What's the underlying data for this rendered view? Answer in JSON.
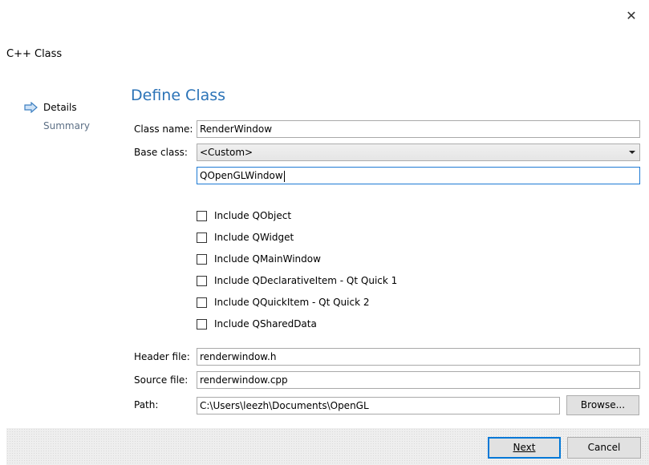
{
  "window": {
    "title": "C++ Class",
    "close_glyph": "✕"
  },
  "nav": {
    "items": [
      {
        "label": "Details",
        "active": true,
        "icon": "arrow-right-icon"
      },
      {
        "label": "Summary",
        "active": false
      }
    ]
  },
  "page": {
    "heading": "Define Class"
  },
  "form": {
    "class_name": {
      "label": "Class name:",
      "value": "RenderWindow"
    },
    "base_class": {
      "label": "Base class:",
      "selected": "<Custom>",
      "custom_value": "QOpenGLWindow"
    },
    "includes": [
      {
        "label": "Include QObject",
        "checked": false
      },
      {
        "label": "Include QWidget",
        "checked": false
      },
      {
        "label": "Include QMainWindow",
        "checked": false
      },
      {
        "label": "Include QDeclarativeItem - Qt Quick 1",
        "checked": false
      },
      {
        "label": "Include QQuickItem - Qt Quick 2",
        "checked": false
      },
      {
        "label": "Include QSharedData",
        "checked": false
      }
    ],
    "header_file": {
      "label": "Header file:",
      "value": "renderwindow.h"
    },
    "source_file": {
      "label": "Source file:",
      "value": "renderwindow.cpp"
    },
    "path": {
      "label": "Path:",
      "value": "C:\\Users\\leezh\\Documents\\OpenGL",
      "browse_label": "Browse..."
    }
  },
  "footer": {
    "next_label": "Next",
    "cancel_label": "Cancel"
  },
  "colors": {
    "accent": "#2b73b7",
    "focus_border": "#1e7ad4",
    "muted_nav": "#5c6f85"
  }
}
